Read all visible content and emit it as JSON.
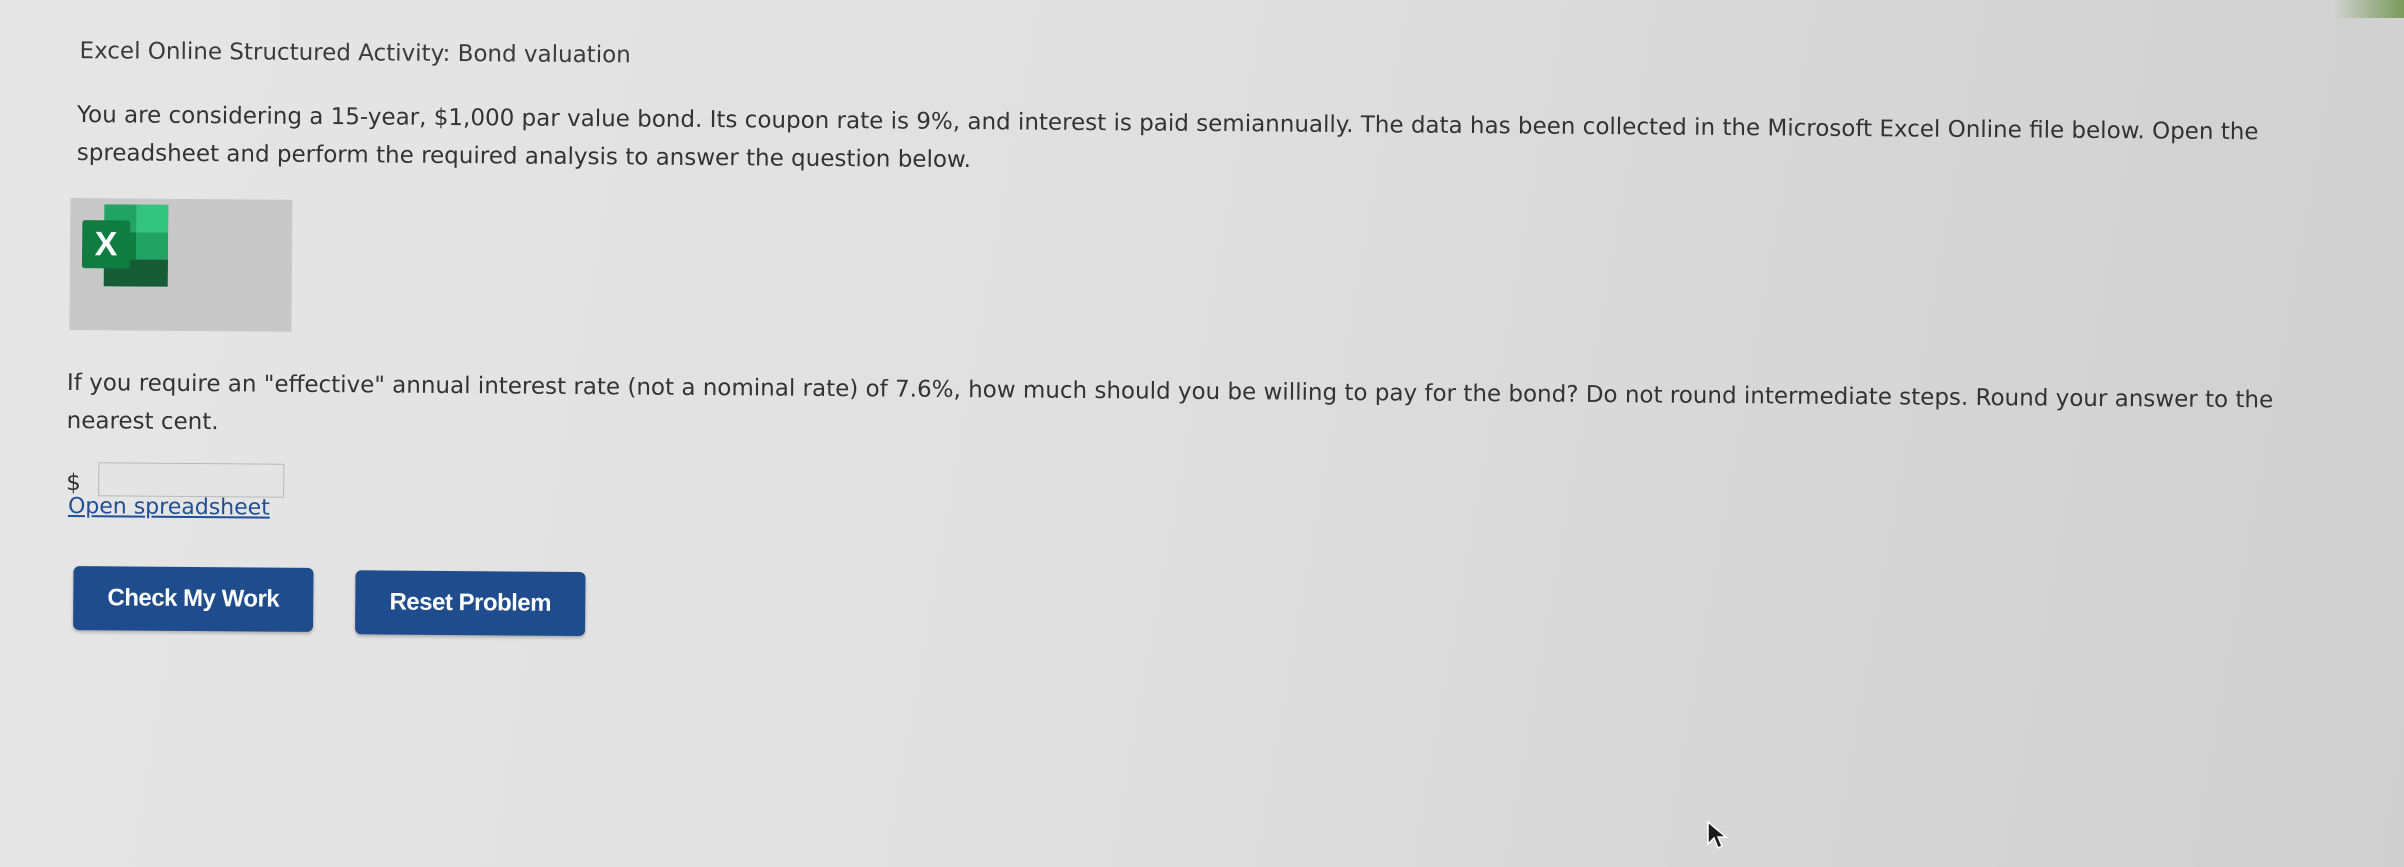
{
  "activity": {
    "title": "Excel Online Structured Activity: Bond valuation"
  },
  "intro": {
    "text": "You are considering a 15-year, $1,000 par value bond. Its coupon rate is 9%, and interest is paid semiannually. The data has been collected in the Microsoft Excel Online file below. Open the spreadsheet and perform the required analysis to answer the question below."
  },
  "spreadsheet": {
    "icon": "excel-icon",
    "icon_letter": "X",
    "link_label": "Open spreadsheet"
  },
  "question": {
    "text": "If you require an \"effective\" annual interest rate (not a nominal rate) of 7.6%, how much should you be willing to pay for the bond? Do not round intermediate steps. Round your answer to the nearest cent."
  },
  "answer": {
    "currency_symbol": "$",
    "value": ""
  },
  "buttons": {
    "check_label": "Check My Work",
    "reset_label": "Reset Problem"
  },
  "colors": {
    "button_bg": "#1e4c8c",
    "link": "#1f4f97",
    "excel_green": "#1d6f42"
  }
}
